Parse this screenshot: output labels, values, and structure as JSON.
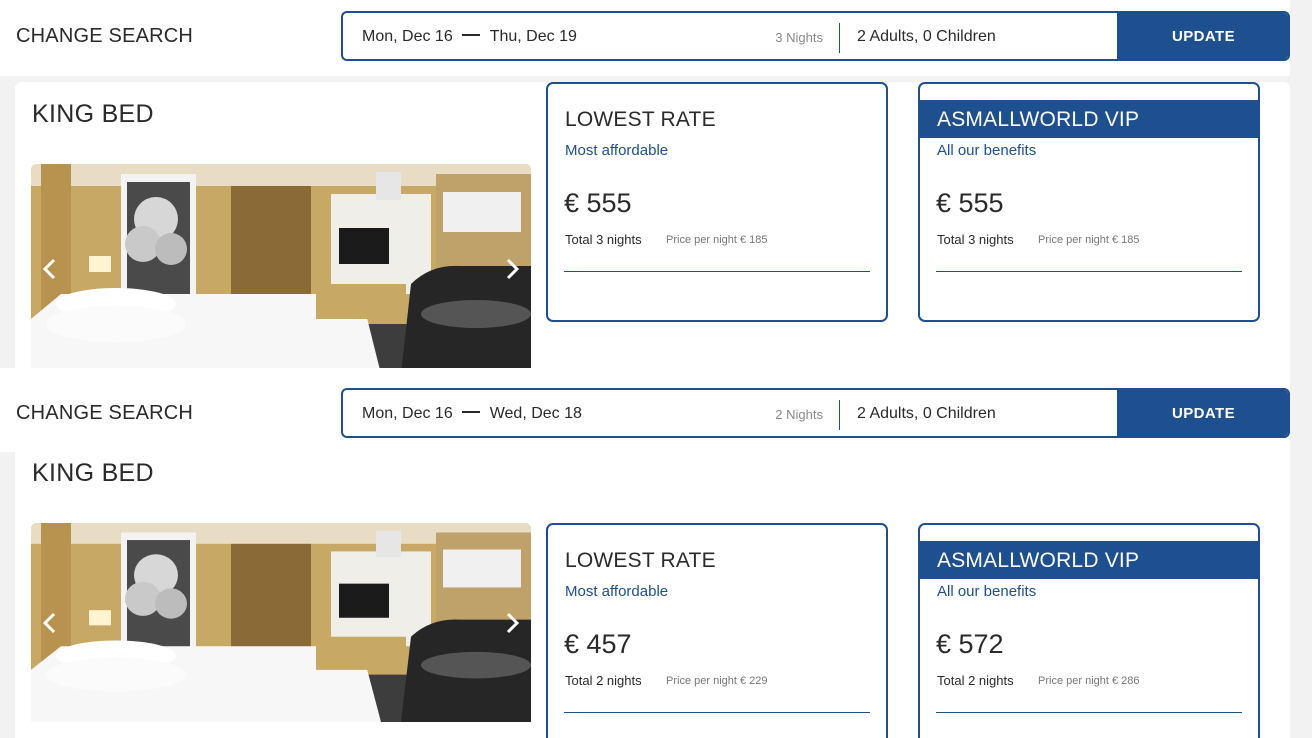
{
  "panels": [
    {
      "search": {
        "title": "CHANGE SEARCH",
        "check_in": "Mon, Dec 16",
        "check_out": "Thu, Dec 19",
        "nights": "3 Nights",
        "guests": "2 Adults, 0 Children",
        "update_label": "UPDATE"
      },
      "room": {
        "title": "KING BED",
        "rates": [
          {
            "name": "LOWEST RATE",
            "subtitle": "Most affordable",
            "price": "€ 555",
            "total": "Total 3 nights",
            "per_night": "Price per night € 185"
          },
          {
            "name": "ASMALLWORLD VIP",
            "subtitle": "All our benefits",
            "price": "€ 555",
            "total": "Total 3 nights",
            "per_night": "Price per night € 185"
          }
        ]
      }
    },
    {
      "search": {
        "title": "CHANGE SEARCH",
        "check_in": "Mon, Dec 16",
        "check_out": "Wed, Dec 18",
        "nights": "2 Nights",
        "guests": "2 Adults, 0 Children",
        "update_label": "UPDATE"
      },
      "room": {
        "title": "KING BED",
        "rates": [
          {
            "name": "LOWEST RATE",
            "subtitle": "Most affordable",
            "price": "€ 457",
            "total": "Total 2 nights",
            "per_night": "Price per night € 229"
          },
          {
            "name": "ASMALLWORLD VIP",
            "subtitle": "All our benefits",
            "price": "€ 572",
            "total": "Total 2 nights",
            "per_night": "Price per night € 286"
          }
        ]
      }
    }
  ],
  "icons": {
    "prev": "chevron-left-icon",
    "next": "chevron-right-icon"
  },
  "colors": {
    "brand_blue": "#1e4f8e",
    "text": "#2a2a2a",
    "muted": "#8a8a8a",
    "page_bg": "#f2f2f2"
  }
}
